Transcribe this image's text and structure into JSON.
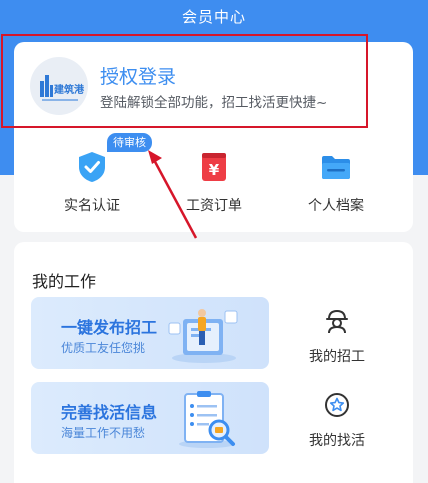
{
  "header": {
    "title": "会员中心"
  },
  "login": {
    "logo_text": "建筑港",
    "title": "授权登录",
    "subtitle": "登陆解锁全部功能，招工找活更快捷~"
  },
  "quick_actions": {
    "badge": "待审核",
    "items": [
      {
        "label": "实名认证",
        "icon": "shield-check-icon"
      },
      {
        "label": "工资订单",
        "icon": "yen-receipt-icon"
      },
      {
        "label": "个人档案",
        "icon": "folder-icon"
      }
    ]
  },
  "work": {
    "title": "我的工作",
    "banners": [
      {
        "title": "一键发布招工",
        "subtitle": "优质工友任您挑"
      },
      {
        "title": "完善找活信息",
        "subtitle": "海量工作不用愁"
      }
    ],
    "side_items": [
      {
        "label": "我的招工",
        "icon": "worker-helmet-icon"
      },
      {
        "label": "我的找活",
        "icon": "star-badge-icon"
      }
    ]
  },
  "colors": {
    "brand_blue": "#3e8df0",
    "annotation_red": "#d6162a"
  }
}
